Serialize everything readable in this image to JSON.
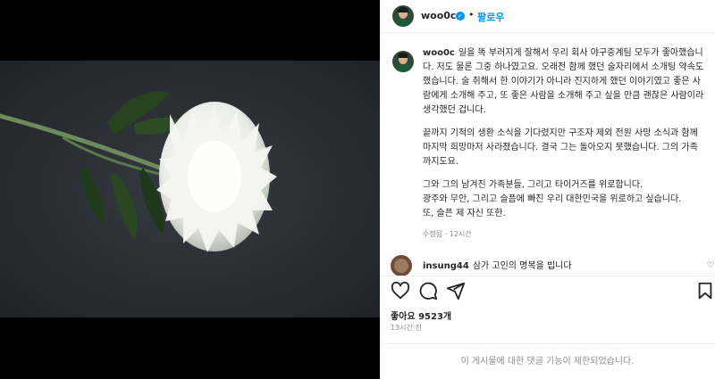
{
  "post": {
    "username": "woo0c",
    "follow_label": "팔로우",
    "caption_paragraphs": [
      "일을 똑 부러지게 잘해서 우리 회사 야구중계팀 모두가 좋아했습니다. 저도 물론 그중 하나였고요. 오래전 함께 했던 술자리에서 소개팅 약속도 했습니다. 술 취해서 한 이야기가 아니라 진지하게 했던 이야기였고 좋은 사람에게 소개해 주고, 또 좋은 사람을 소개해 주고 싶을 만큼 괜찮은 사람이라 생각했던 겁니다.",
      "끝까지 기적의 생환 소식을 기다렸지만 구조자 제외 전원 사망 소식과 함께 마지막 희망마저 사라졌습니다. 결국 그는 돌아오지 못했습니다. 그의 가족까지도요.",
      "그와 그의 남겨진 가족분들, 그리고 타이거즈를 위로합니다.\n광주와 무안, 그리고 슬픔에 빠진 우리 대한민국을 위로하고 싶습니다.\n또, 슬픈 제 자신 또한."
    ],
    "edited_label": "수정됨",
    "caption_time": "12시간",
    "likes_label": "좋아요 9523개",
    "posted_ago": "13시간 전",
    "comments_restricted": "이 게시물에 대한 댓글 기능이 제한되었습니다."
  },
  "comments": [
    {
      "username": "insung44",
      "text": "삼가 고인의 명복을 빕니다"
    }
  ],
  "icons": [
    "heart-icon",
    "comment-icon",
    "share-icon",
    "bookmark-icon",
    "verified-badge-icon"
  ],
  "colors": {
    "accent": "#0095f6",
    "muted": "#8e8e8e",
    "text": "#262626"
  }
}
